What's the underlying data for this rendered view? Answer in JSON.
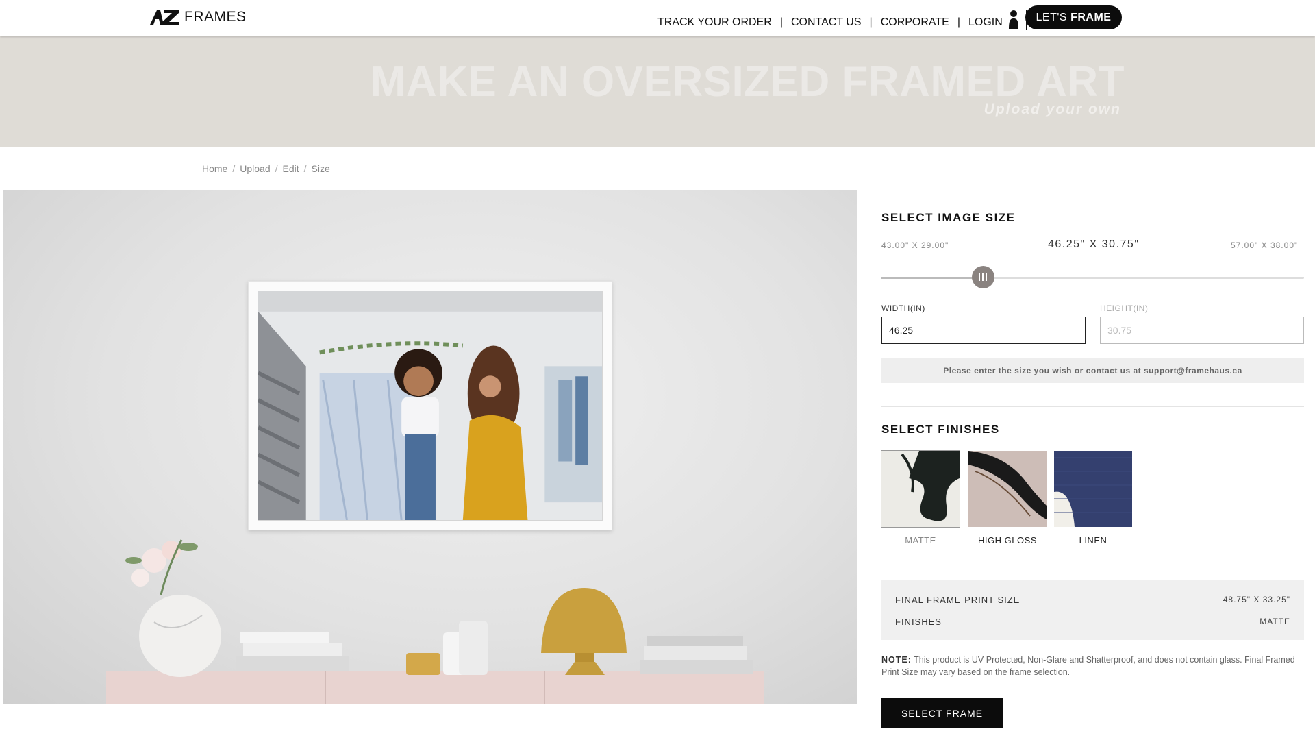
{
  "header": {
    "logo_text": "FRAMES",
    "nav": [
      "TRACK YOUR ORDER",
      "CONTACT US",
      "CORPORATE",
      "LOGIN"
    ],
    "separator": "|",
    "cta_prefix": "LET'S",
    "cta_bold": "FRAME"
  },
  "hero": {
    "title": "MAKE AN OVERSIZED FRAMED ART",
    "subtitle": "Upload your own"
  },
  "breadcrumb": [
    "Home",
    "Upload",
    "Edit",
    "Size"
  ],
  "size": {
    "title": "SELECT IMAGE SIZE",
    "min_label": "43.00\" X 29.00\"",
    "current_label": "46.25\" X 30.75\"",
    "max_label": "57.00\" X 38.00\"",
    "slider_fraction": 0.24,
    "width_label": "WIDTH(IN)",
    "width_value": "46.25",
    "height_label": "HEIGHT(IN)",
    "height_value": "30.75",
    "help_text": "Please enter the size you wish or contact us at support@framehaus.ca"
  },
  "finishes": {
    "title": "SELECT FINISHES",
    "options": [
      {
        "label": "MATTE",
        "selected": true
      },
      {
        "label": "HIGH GLOSS",
        "selected": false
      },
      {
        "label": "LINEN",
        "selected": false
      }
    ]
  },
  "summary": {
    "print_size_label": "FINAL FRAME PRINT SIZE",
    "print_size_value": "48.75\" X 33.25\"",
    "finish_label": "FINISHES",
    "finish_value": "MATTE"
  },
  "note": {
    "prefix": "NOTE:",
    "text": "This product is UV Protected, Non-Glare and Shatterproof, and does not contain glass. Final Framed Print Size may vary based on the frame selection."
  },
  "select_frame_label": "SELECT FRAME",
  "colors": {
    "accent": "#0c0c0c",
    "hero_bg": "#dfdcd6",
    "slider_thumb": "#8a8380"
  },
  "icons": [
    "user-icon",
    "cart-icon"
  ]
}
